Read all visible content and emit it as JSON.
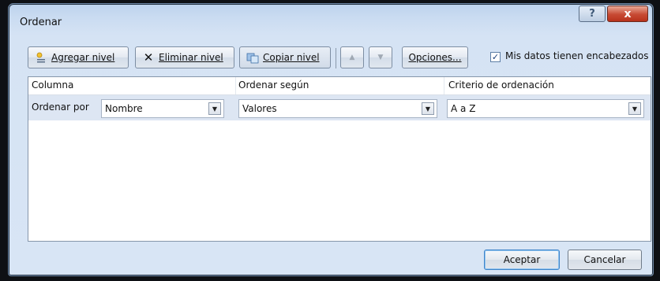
{
  "window": {
    "title": "Ordenar",
    "help_label": "?",
    "close_label": "x"
  },
  "toolbar": {
    "add_level_label": "Agregar nivel",
    "delete_level_label": "Eliminar nivel",
    "copy_level_label": "Copiar nivel",
    "options_label": "Opciones...",
    "headers_checkbox_label": "Mis datos tienen encabezados",
    "headers_checked": true
  },
  "grid": {
    "headers": [
      "Columna",
      "Ordenar según",
      "Criterio de ordenación"
    ],
    "rows": [
      {
        "label": "Ordenar por",
        "column": "Nombre",
        "sort_on": "Valores",
        "order": "A a Z"
      }
    ]
  },
  "footer": {
    "ok_label": "Aceptar",
    "cancel_label": "Cancelar"
  }
}
